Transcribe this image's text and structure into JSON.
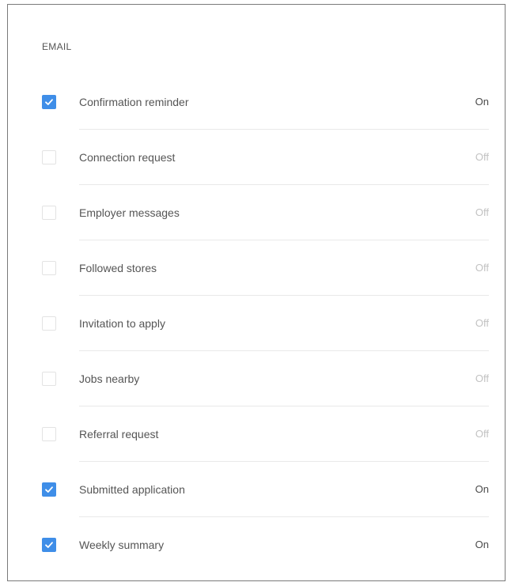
{
  "section": {
    "title": "EMAIL"
  },
  "colors": {
    "checked": "#3f8ee8",
    "divider": "#e9e9e9"
  },
  "items": [
    {
      "label": "Confirmation reminder",
      "status": "On",
      "checked": true,
      "icon": "check-icon"
    },
    {
      "label": "Connection request",
      "status": "Off",
      "checked": false,
      "icon": "check-icon"
    },
    {
      "label": "Employer messages",
      "status": "Off",
      "checked": false,
      "icon": "check-icon"
    },
    {
      "label": "Followed stores",
      "status": "Off",
      "checked": false,
      "icon": "check-icon"
    },
    {
      "label": "Invitation to apply",
      "status": "Off",
      "checked": false,
      "icon": "check-icon"
    },
    {
      "label": "Jobs nearby",
      "status": "Off",
      "checked": false,
      "icon": "check-icon"
    },
    {
      "label": "Referral request",
      "status": "Off",
      "checked": false,
      "icon": "check-icon"
    },
    {
      "label": "Submitted application",
      "status": "On",
      "checked": true,
      "icon": "check-icon"
    },
    {
      "label": "Weekly summary",
      "status": "On",
      "checked": true,
      "icon": "check-icon"
    }
  ]
}
